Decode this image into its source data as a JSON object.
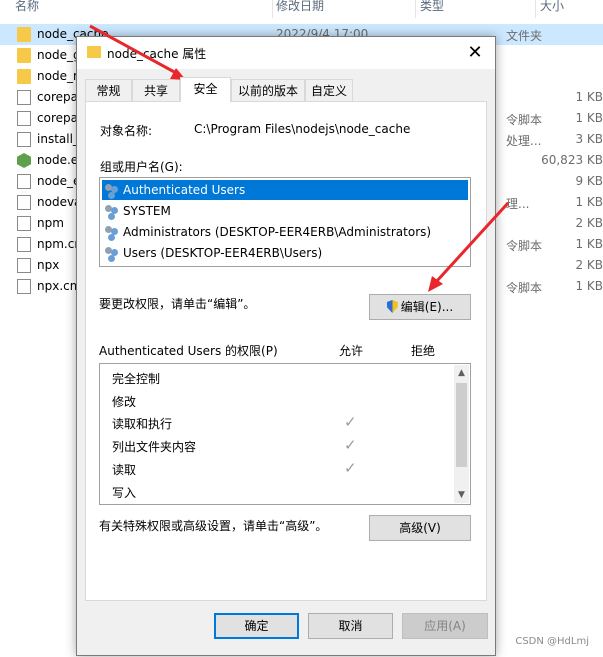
{
  "explorer": {
    "columns": {
      "name": "名称",
      "date": "修改日期",
      "type": "类型",
      "size": "大小"
    },
    "rows": [
      {
        "name": "node_cache",
        "date": "2022/9/4 17:00",
        "type": "文件夹",
        "size": "",
        "icon": "folder-icon"
      },
      {
        "name": "node_g",
        "date": "",
        "type": "",
        "size": "",
        "icon": "folder-icon"
      },
      {
        "name": "node_r",
        "date": "",
        "type": "",
        "size": "",
        "icon": "folder-icon"
      },
      {
        "name": "corepa",
        "date": "",
        "type": "",
        "size": "1 KB",
        "icon": "file-icon"
      },
      {
        "name": "corepa",
        "date": "",
        "type": "令脚本",
        "size": "1 KB",
        "icon": "script-icon"
      },
      {
        "name": "install_",
        "date": "",
        "type": "处理...",
        "size": "3 KB",
        "icon": "script-icon"
      },
      {
        "name": "node.e",
        "date": "",
        "type": "",
        "size": "60,823 KB",
        "icon": "node-icon"
      },
      {
        "name": "node_e",
        "date": "",
        "type": "",
        "size": "9 KB",
        "icon": "file-icon"
      },
      {
        "name": "nodeva",
        "date": "",
        "type": "理...",
        "size": "1 KB",
        "icon": "script-icon"
      },
      {
        "name": "npm",
        "date": "",
        "type": "",
        "size": "2 KB",
        "icon": "file-icon"
      },
      {
        "name": "npm.cr",
        "date": "",
        "type": "令脚本",
        "size": "1 KB",
        "icon": "script-icon"
      },
      {
        "name": "npx",
        "date": "",
        "type": "",
        "size": "2 KB",
        "icon": "file-icon"
      },
      {
        "name": "npx.cm",
        "date": "",
        "type": "令脚本",
        "size": "1 KB",
        "icon": "script-icon"
      }
    ]
  },
  "dialog": {
    "title": "node_cache 属性",
    "close": "✕",
    "tabs": [
      "常规",
      "共享",
      "安全",
      "以前的版本",
      "自定义"
    ],
    "active_tab": "安全",
    "object_label": "对象名称:",
    "object_value": "C:\\Program Files\\nodejs\\node_cache",
    "group_label": "组或用户名(G):",
    "users": [
      "Authenticated Users",
      "SYSTEM",
      "Administrators (DESKTOP-EER4ERB\\Administrators)",
      "Users (DESKTOP-EER4ERB\\Users)"
    ],
    "selected_user": "Authenticated Users",
    "change_perm_text": "要更改权限，请单击“编辑”。",
    "edit_button": "编辑(E)...",
    "perm_header": "Authenticated Users 的权限(P)",
    "allow_label": "允许",
    "deny_label": "拒绝",
    "permissions": [
      {
        "name": "完全控制",
        "allow": false
      },
      {
        "name": "修改",
        "allow": false
      },
      {
        "name": "读取和执行",
        "allow": true
      },
      {
        "name": "列出文件夹内容",
        "allow": true
      },
      {
        "name": "读取",
        "allow": true
      },
      {
        "name": "写入",
        "allow": false
      }
    ],
    "check_glyph": "✓",
    "special_text": "有关特殊权限或高级设置，请单击“高级”。",
    "advanced_button": "高级(V)",
    "ok_button": "确定",
    "cancel_button": "取消",
    "apply_button": "应用(A)"
  },
  "watermark": "CSDN @HdLmj",
  "colors": {
    "selection": "#0078d7",
    "annotation_arrow": "#e8262b",
    "folder": "#f7c948"
  }
}
